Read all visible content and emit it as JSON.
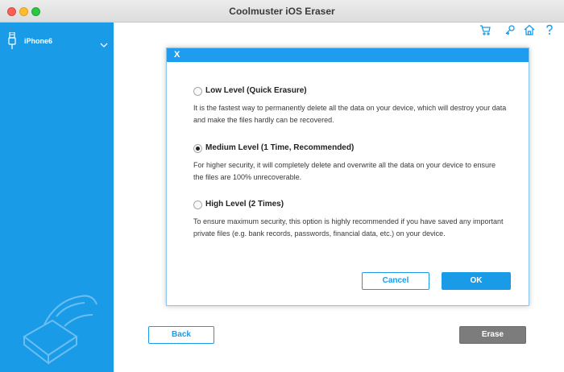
{
  "window": {
    "title": "Coolmuster iOS Eraser"
  },
  "sidebar": {
    "device_label": "iPhone6"
  },
  "toolbar": {
    "icons": [
      "cart-icon",
      "key-icon",
      "home-icon",
      "help-icon"
    ]
  },
  "dialog": {
    "close_label": "X",
    "options": [
      {
        "title": "Low Level (Quick Erasure)",
        "description": "It is the fastest way to permanently delete all the data on your device, which will destroy your data and make the files hardly can be recovered.",
        "selected": false
      },
      {
        "title": "Medium Level (1 Time, Recommended)",
        "description": "For higher security, it will completely delete and overwrite all the data on your device to ensure the files are 100% unrecoverable.",
        "selected": true
      },
      {
        "title": "High Level (2 Times)",
        "description": "To ensure maximum security, this option is highly recommended if you have saved any important private files (e.g. bank records, passwords, financial data, etc.) on your device.",
        "selected": false
      }
    ],
    "cancel_label": "Cancel",
    "ok_label": "OK"
  },
  "footer": {
    "back_label": "Back",
    "erase_label": "Erase"
  },
  "colors": {
    "accent": "#1a9be8",
    "dialog_header": "#1e9cf0",
    "erase_disabled": "#7c7c7c"
  }
}
